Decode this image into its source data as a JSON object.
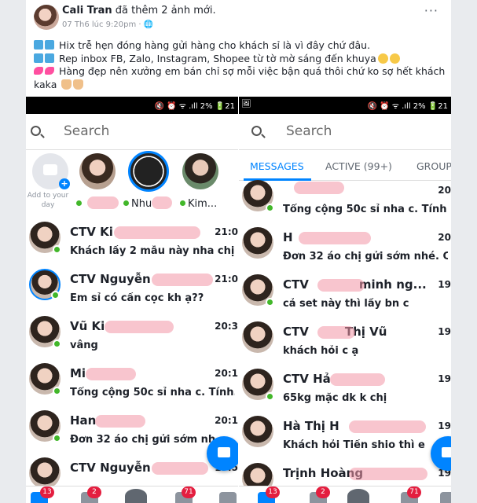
{
  "post": {
    "author": "Cali Tran",
    "action": "đã thêm 2 ảnh mới.",
    "time": "07 Th6 lúc 9:20pm · 🌐",
    "more": "···",
    "lines": [
      "Hix trễ hẹn đóng hàng gửi hàng cho khách sỉ là vì đây chứ đâu.",
      "Rep inbox FB, Zalo, Instagram, Shopee từ tờ mờ sáng đến khuya",
      "Hàng đẹp nên xưởng em bán chỉ sợ mỗi việc bận quá thôi chứ ko sợ hết khách",
      "kaka"
    ]
  },
  "left": {
    "status_right": "🔇 ⏰ ᯤ .ıll 2% 🔋21",
    "search_placeholder": "Search",
    "add_story_label": "Add to your day",
    "story_names": [
      "",
      "Nhu",
      "Kim..."
    ],
    "conversations": [
      {
        "name": "CTV Ki",
        "time": "21:0",
        "preview": "Khách lấy 2 mẫu này nha chị",
        "online": true
      },
      {
        "name": "CTV Nguyễn",
        "time": "21:0",
        "preview": "Em sỉ có cần cọc kh ạ??",
        "online": true
      },
      {
        "name": "Vũ Ki",
        "time": "20:3",
        "preview": "vâng",
        "online": true
      },
      {
        "name": "Mi",
        "time": "20:1",
        "preview": "Tổng cộng 50c sỉ nha c. Tính...",
        "online": true
      },
      {
        "name": "Han",
        "time": "20:1",
        "preview": "Đơn 32 áo chị gửi sớm nh",
        "online": true
      },
      {
        "name": "CTV Nguyễn",
        "time": "19:5",
        "preview": "",
        "online": false
      }
    ],
    "badges": [
      "13",
      "2",
      "71"
    ]
  },
  "right": {
    "status_left": "🖼",
    "status_right": "🔇 ⏰ ᯤ .ıll 2% 🔋21",
    "search_placeholder": "Search",
    "tabs": [
      "MESSAGES",
      "ACTIVE (99+)",
      "GROUP"
    ],
    "conversations": [
      {
        "name": "",
        "time": "20",
        "preview": "Tổng cộng 50c sỉ nha c. Tính",
        "online": true
      },
      {
        "name": "H",
        "time": "20",
        "preview": "Đơn 32 áo chị gửi sớm nhé. C",
        "online": false
      },
      {
        "name": "CTV",
        "name2": "minh ng...",
        "time": "19",
        "preview": "cả set này thì lấy bn c",
        "online": true
      },
      {
        "name": "CTV",
        "name2": "Thị Vũ",
        "time": "19",
        "preview": "khách hỏi c ạ",
        "online": false
      },
      {
        "name": "CTV Hả",
        "time": "19",
        "preview": "65kg mặc dk k chị",
        "online": true
      },
      {
        "name": "Hà Thị H",
        "time": "19",
        "preview": "Khách hỏi Tiền shio thì e",
        "online": false
      },
      {
        "name": "Trịnh Hoàng",
        "time": "19",
        "preview": "",
        "online": false
      }
    ],
    "badges": [
      "13",
      "2",
      "71"
    ]
  }
}
